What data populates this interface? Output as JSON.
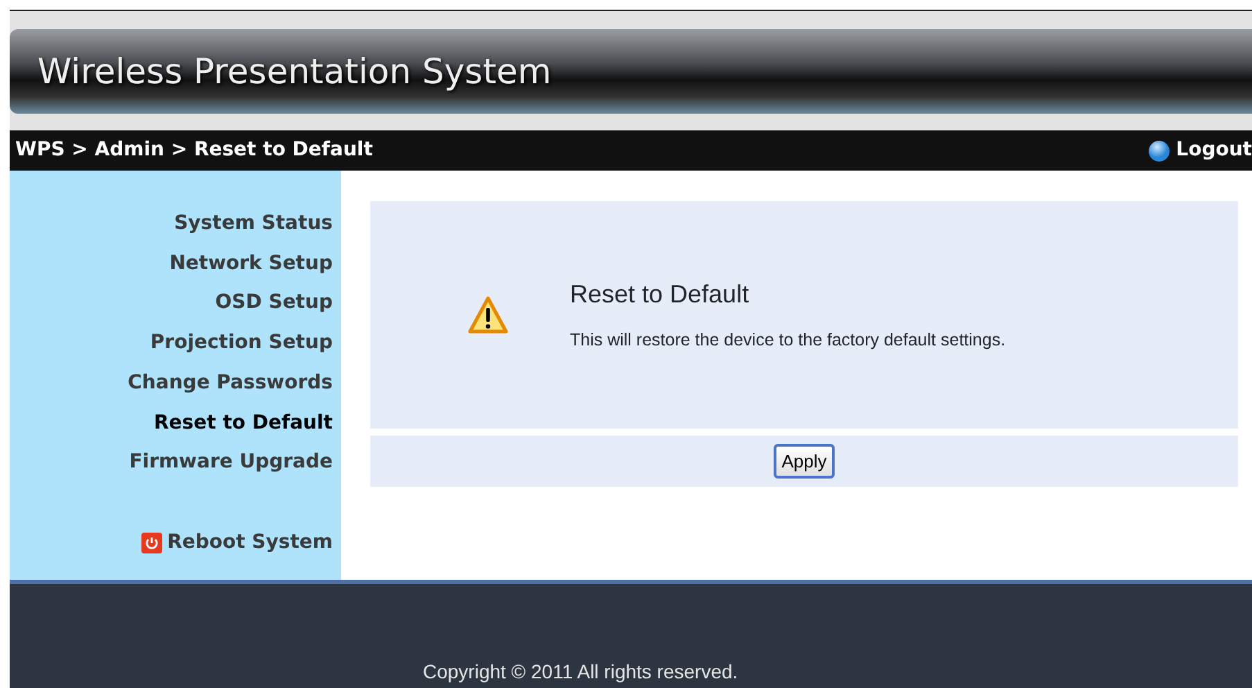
{
  "header": {
    "title": "Wireless Presentation System"
  },
  "breadcrumb": {
    "path": "WPS > Admin > Reset to Default",
    "logout": "Logout"
  },
  "sidebar": {
    "items": [
      {
        "label": "System Status",
        "selected": false
      },
      {
        "label": "Network Setup",
        "selected": false
      },
      {
        "label": "OSD Setup",
        "selected": false
      },
      {
        "label": "Projection Setup",
        "selected": false
      },
      {
        "label": "Change Passwords",
        "selected": false
      },
      {
        "label": "Reset to Default",
        "selected": true
      },
      {
        "label": "Firmware Upgrade",
        "selected": false
      }
    ],
    "reboot": "Reboot System"
  },
  "panel": {
    "title": "Reset to Default",
    "message": "This will restore the device to the factory default settings.",
    "button": "Apply"
  },
  "footer": {
    "copyright": "Copyright © 2011 All rights reserved."
  }
}
